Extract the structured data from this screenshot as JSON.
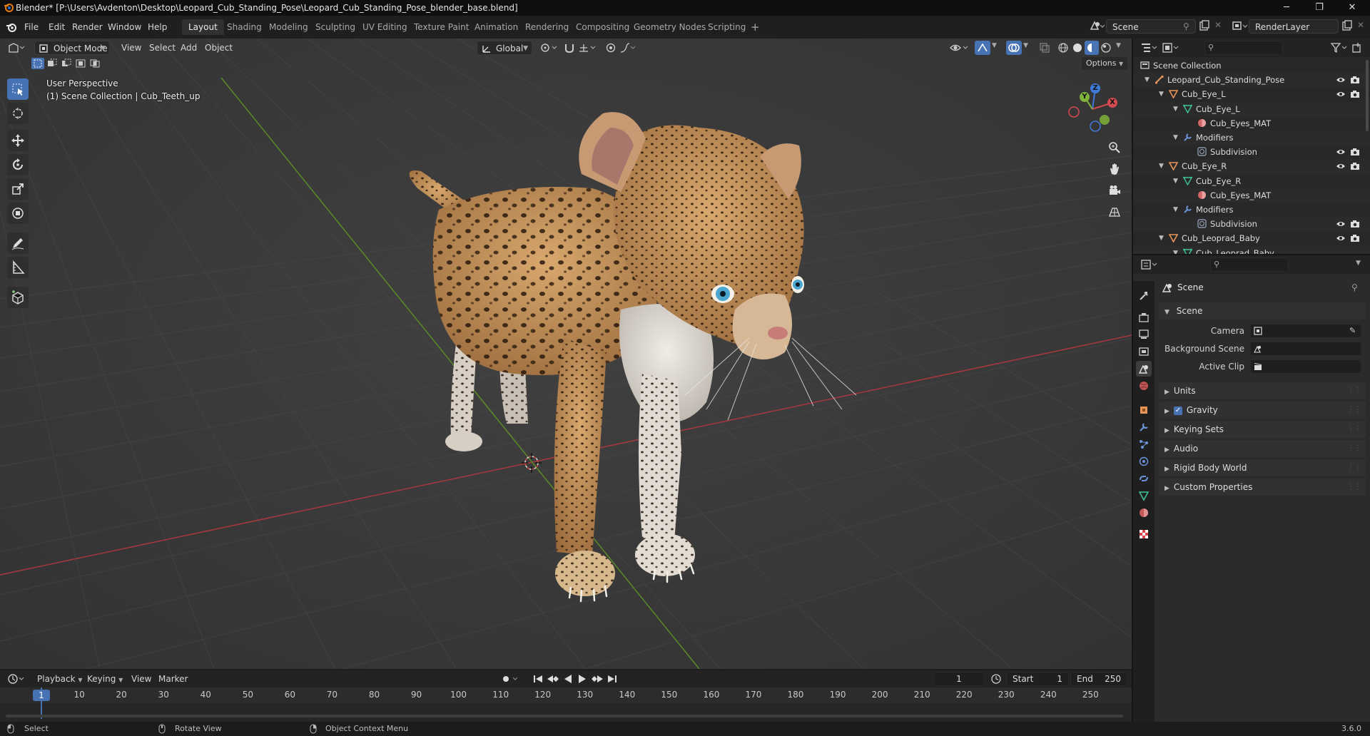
{
  "window": {
    "title": "Blender* [P:\\Users\\Avdenton\\Desktop\\Leopard_Cub_Standing_Pose\\Leopard_Cub_Standing_Pose_blender_base.blend]",
    "minimize": "─",
    "restore": "❐",
    "close": "✕"
  },
  "menubar": {
    "items": [
      "File",
      "Edit",
      "Render",
      "Window",
      "Help"
    ],
    "workspaces": [
      "Layout",
      "Shading",
      "Modeling",
      "Sculpting",
      "UV Editing",
      "Texture Paint",
      "Animation",
      "Rendering",
      "Compositing",
      "Geometry Nodes",
      "Scripting"
    ],
    "active_workspace": "Layout",
    "add_workspace": "+",
    "scene": "Scene",
    "render_layer": "RenderLayer"
  },
  "viewport": {
    "mode": "Object Mode",
    "menus": [
      "View",
      "Select",
      "Add",
      "Object"
    ],
    "orientation": "Global",
    "options": "Options",
    "perspective_label": "User Perspective",
    "collection_label": "(1) Scene Collection | Cub_Teeth_up",
    "gizmo": {
      "z": "Z",
      "y": "Y",
      "x": "X"
    }
  },
  "outliner": {
    "search_placeholder": "",
    "rows": [
      {
        "label": "Scene Collection",
        "icon": "scene-collection-icon",
        "color": "#cfcfcf"
      },
      {
        "label": "Leopard_Cub_Standing_Pose",
        "icon": "armature-icon",
        "color": "#e8955a"
      },
      {
        "label": "Cub_Eye_L",
        "icon": "object-icon",
        "color": "#e8955a"
      },
      {
        "label": "Cub_Eye_L",
        "icon": "mesh-icon",
        "color": "#3ec49b"
      },
      {
        "label": "Cub_Eyes_MAT",
        "icon": "material-icon",
        "color": "#d26565"
      },
      {
        "label": "Modifiers",
        "icon": "wrench-icon",
        "color": "#6a94d8"
      },
      {
        "label": "Subdivision",
        "icon": "modifier-icon",
        "color": "#9aa7c0"
      },
      {
        "label": "Cub_Eye_R",
        "icon": "object-icon",
        "color": "#e8955a"
      },
      {
        "label": "Cub_Eye_R",
        "icon": "mesh-icon",
        "color": "#3ec49b"
      },
      {
        "label": "Cub_Eyes_MAT",
        "icon": "material-icon",
        "color": "#d26565"
      },
      {
        "label": "Modifiers",
        "icon": "wrench-icon",
        "color": "#6a94d8"
      },
      {
        "label": "Subdivision",
        "icon": "modifier-icon",
        "color": "#9aa7c0"
      },
      {
        "label": "Cub_Leoprad_Baby",
        "icon": "object-icon",
        "color": "#e8955a"
      },
      {
        "label": "Cub_Leoprad_Baby",
        "icon": "mesh-icon",
        "color": "#3ec49b"
      }
    ]
  },
  "properties": {
    "context_title": "Scene",
    "scene_panel": "Scene",
    "camera_label": "Camera",
    "background_scene_label": "Background Scene",
    "active_clip_label": "Active Clip",
    "collapsed_panels": [
      "Units",
      "Gravity",
      "Keying Sets",
      "Audio",
      "Rigid Body World",
      "Custom Properties"
    ],
    "gravity_checked": true
  },
  "timeline": {
    "menus": [
      "Playback",
      "Keying",
      "View",
      "Marker"
    ],
    "current_frame": "1",
    "start_label": "Start",
    "start_value": "1",
    "end_label": "End",
    "end_value": "250",
    "ruler": [
      "1",
      "10",
      "20",
      "30",
      "40",
      "50",
      "60",
      "70",
      "80",
      "90",
      "100",
      "110",
      "120",
      "130",
      "140",
      "150",
      "160",
      "170",
      "180",
      "190",
      "200",
      "210",
      "220",
      "230",
      "240",
      "250"
    ]
  },
  "statusbar": {
    "select": "Select",
    "rotate": "Rotate View",
    "context_menu": "Object Context Menu",
    "version": "3.6.0"
  },
  "colors": {
    "accent": "#4772b3",
    "x_axis": "#c2434a",
    "y_axis": "#6a9c2f",
    "gizmo_x": "#d34a50",
    "gizmo_y": "#7fb23a",
    "gizmo_z": "#3f7ad8"
  }
}
